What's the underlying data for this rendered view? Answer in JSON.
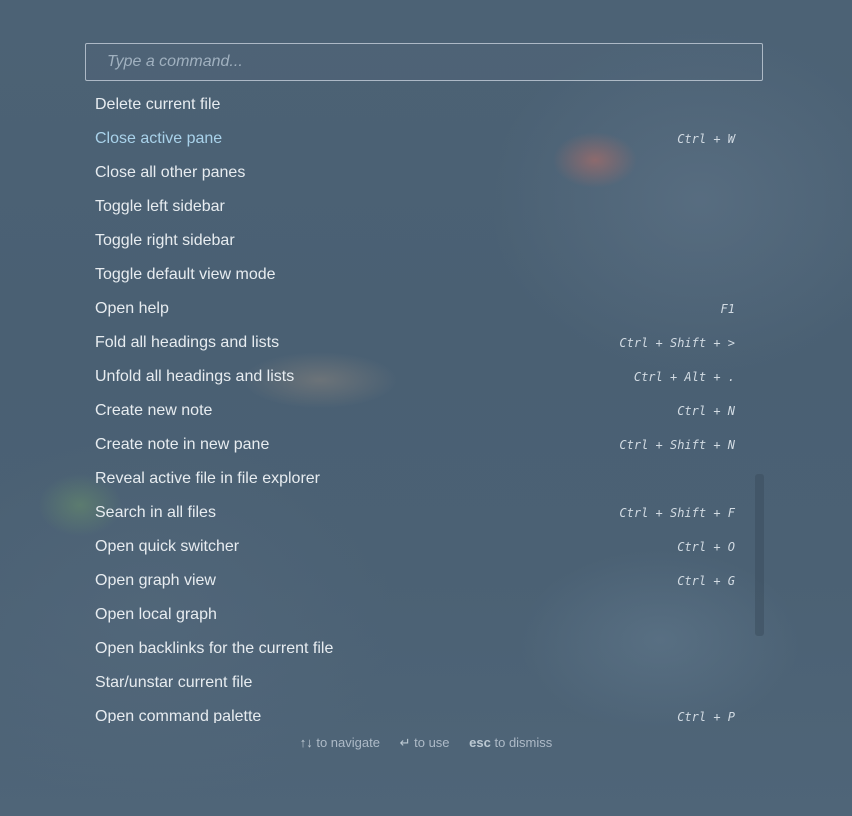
{
  "prompt": {
    "placeholder": "Type a command...",
    "value": ""
  },
  "commands": [
    {
      "name": "Delete current file",
      "hotkey": ""
    },
    {
      "name": "Close active pane",
      "hotkey": "Ctrl + W"
    },
    {
      "name": "Close all other panes",
      "hotkey": ""
    },
    {
      "name": "Toggle left sidebar",
      "hotkey": ""
    },
    {
      "name": "Toggle right sidebar",
      "hotkey": ""
    },
    {
      "name": "Toggle default view mode",
      "hotkey": ""
    },
    {
      "name": "Open help",
      "hotkey": "F1"
    },
    {
      "name": "Fold all headings and lists",
      "hotkey": "Ctrl + Shift + >"
    },
    {
      "name": "Unfold all headings and lists",
      "hotkey": "Ctrl + Alt + ."
    },
    {
      "name": "Create new note",
      "hotkey": "Ctrl + N"
    },
    {
      "name": "Create note in new pane",
      "hotkey": "Ctrl + Shift + N"
    },
    {
      "name": "Reveal active file in file explorer",
      "hotkey": ""
    },
    {
      "name": "Search in all files",
      "hotkey": "Ctrl + Shift + F"
    },
    {
      "name": "Open quick switcher",
      "hotkey": "Ctrl + O"
    },
    {
      "name": "Open graph view",
      "hotkey": "Ctrl + G"
    },
    {
      "name": "Open local graph",
      "hotkey": ""
    },
    {
      "name": "Open backlinks for the current file",
      "hotkey": ""
    },
    {
      "name": "Star/unstar current file",
      "hotkey": ""
    },
    {
      "name": "Open command palette",
      "hotkey": "Ctrl + P"
    }
  ],
  "selected_index": 1,
  "instructions": {
    "navigate_key": "↑↓",
    "navigate_text": "to navigate",
    "use_key": "↵",
    "use_text": "to use",
    "dismiss_key": "esc",
    "dismiss_text": "to dismiss"
  }
}
